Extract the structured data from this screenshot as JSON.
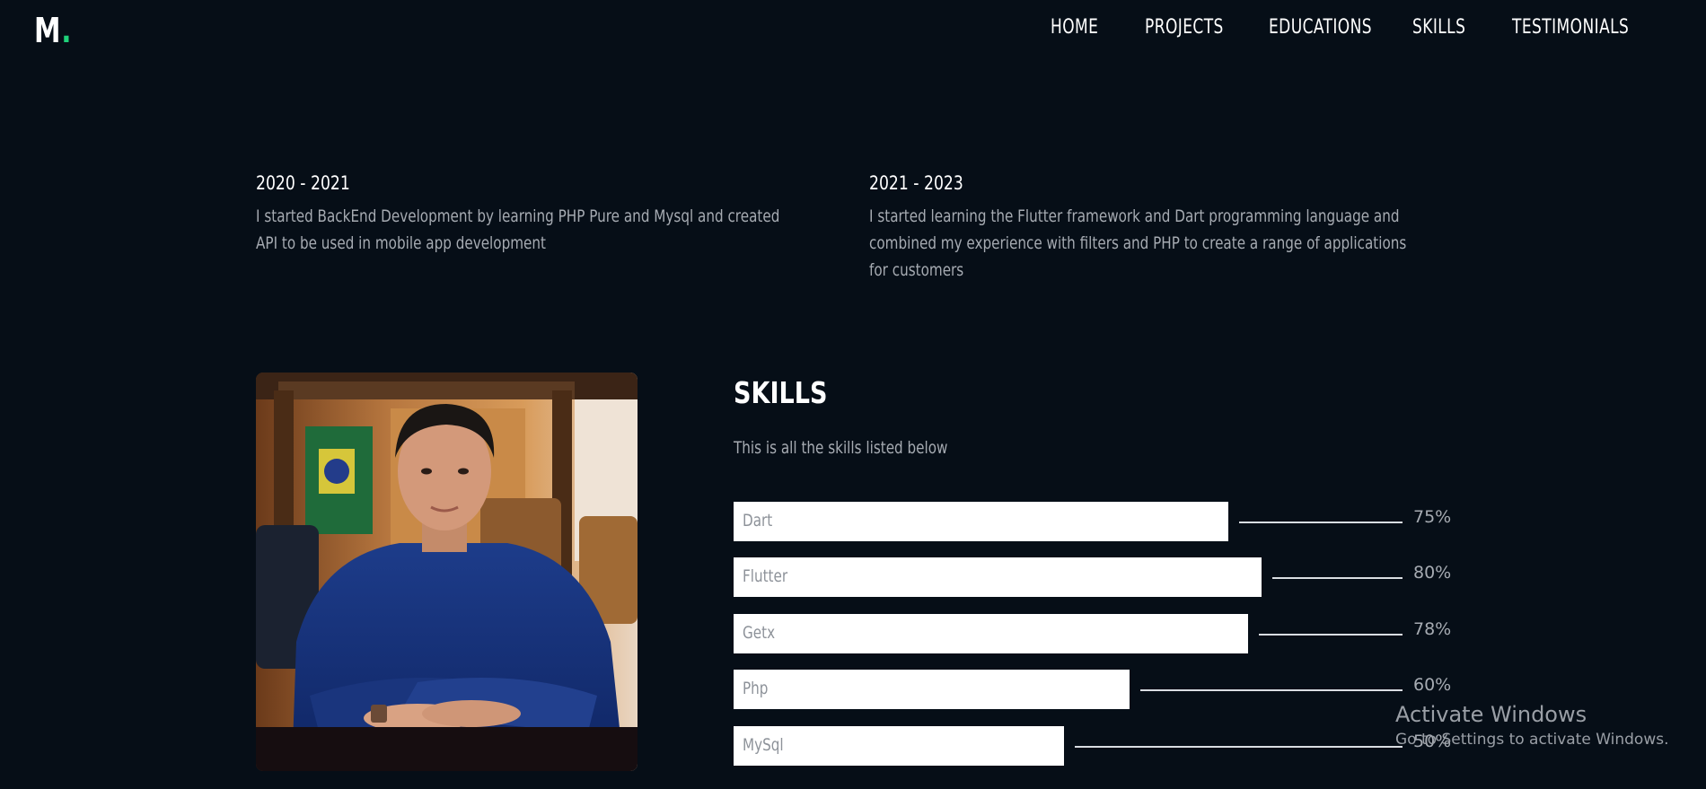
{
  "logo": {
    "letter": "M",
    "dot": "."
  },
  "nav": {
    "items": [
      {
        "label": "HOME"
      },
      {
        "label": "PROJECTS"
      },
      {
        "label": "EDUCATIONS"
      },
      {
        "label": "SKILLS"
      },
      {
        "label": "TESTIMONIALS"
      }
    ]
  },
  "education": [
    {
      "years": "2020 - 2021",
      "description": "I started BackEnd Development by learning PHP Pure and Mysql and created API to be used in mobile app development"
    },
    {
      "years": "2021 - 2023",
      "description": "I started learning the Flutter framework and Dart programming language and combined my experience with filters and PHP to create a range of applications for customers"
    }
  ],
  "skills": {
    "title": "SKILLS",
    "subtitle": "This is all the skills listed below",
    "items": [
      {
        "name": "Dart",
        "percent_label": "75%",
        "percent": 75
      },
      {
        "name": "Flutter",
        "percent_label": "80%",
        "percent": 80
      },
      {
        "name": "Getx",
        "percent_label": "78%",
        "percent": 78
      },
      {
        "name": "Php",
        "percent_label": "60%",
        "percent": 60
      },
      {
        "name": "MySql",
        "percent_label": "50%",
        "percent": 50
      }
    ]
  },
  "watermark": {
    "title": "Activate Windows",
    "subtitle": "Go to Settings to activate Windows."
  },
  "colors": {
    "background": "#060e17",
    "accent": "#1fd17a",
    "text": "#ffffff",
    "muted": "#a6abb2"
  }
}
